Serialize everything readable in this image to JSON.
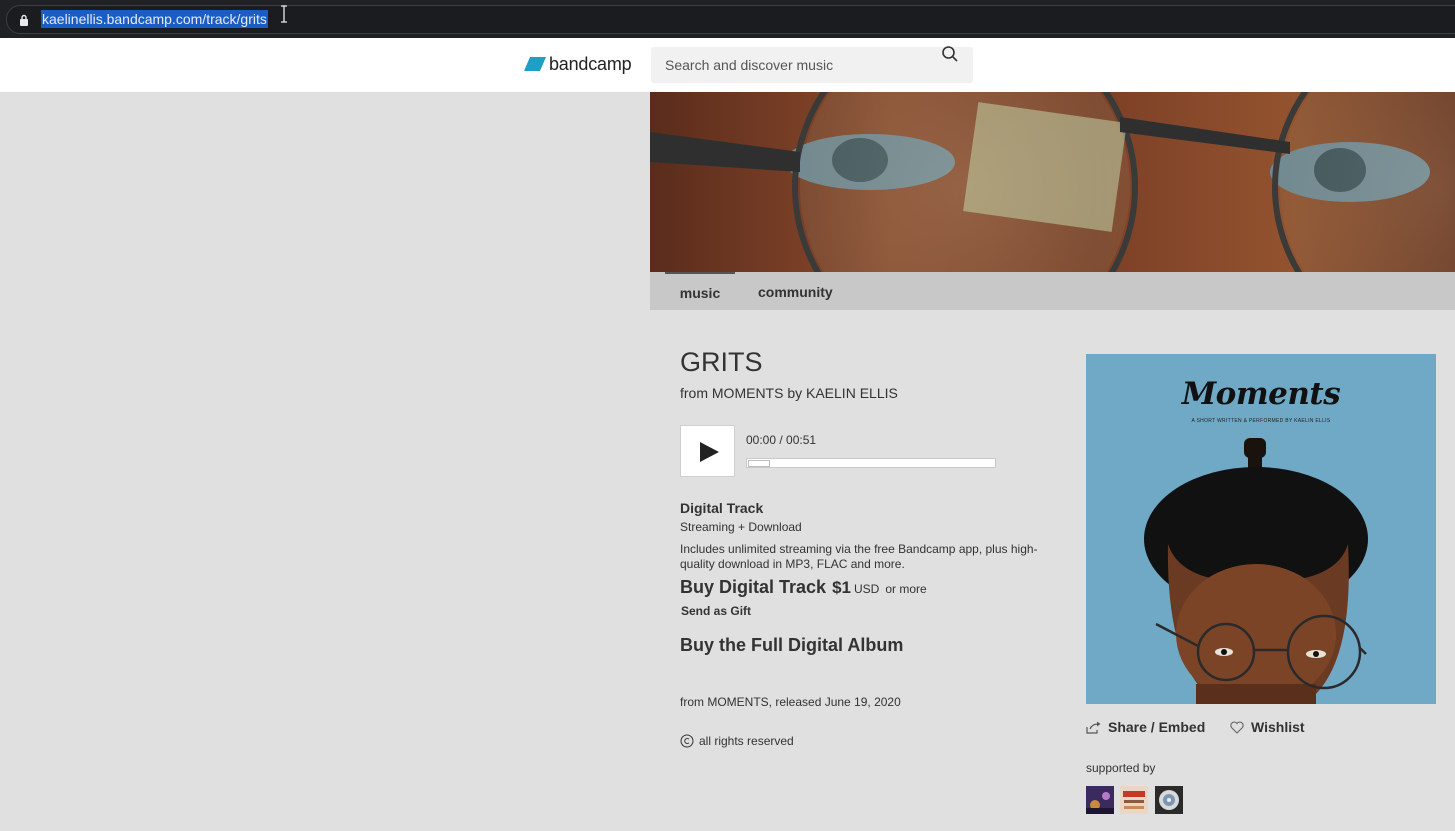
{
  "browser": {
    "url": "kaelinellis.bandcamp.com/track/grits"
  },
  "header": {
    "logo_text": "bandcamp",
    "search_placeholder": "Search and discover music",
    "brand_color": "#1da0c3"
  },
  "nav": {
    "tabs": [
      {
        "label": "music"
      },
      {
        "label": "community"
      }
    ]
  },
  "track": {
    "title": "GRITS",
    "from_line": "from MOMENTS by KAELIN ELLIS",
    "time": "00:00 / 00:51"
  },
  "purchase": {
    "format_title": "Digital Track",
    "format_sub": "Streaming + Download",
    "description": "Includes unlimited streaming via the free Bandcamp app, plus high-quality download in MP3, FLAC and more.",
    "buy_label": "Buy Digital Track",
    "price": "$1",
    "currency": "USD",
    "or_more": "or more",
    "gift_label": "Send as Gift",
    "full_album_label": "Buy the Full Digital Album"
  },
  "release": {
    "released_text": "from MOMENTS, released June 19, 2020",
    "rights_text": "all rights reserved"
  },
  "album_art": {
    "title": "Moments",
    "subtitle": "A SHORT WRITTEN & PERFORMED BY KAELIN ELLIS"
  },
  "actions": {
    "share_label": "Share / Embed",
    "wishlist_label": "Wishlist"
  },
  "supporters": {
    "label": "supported by"
  }
}
